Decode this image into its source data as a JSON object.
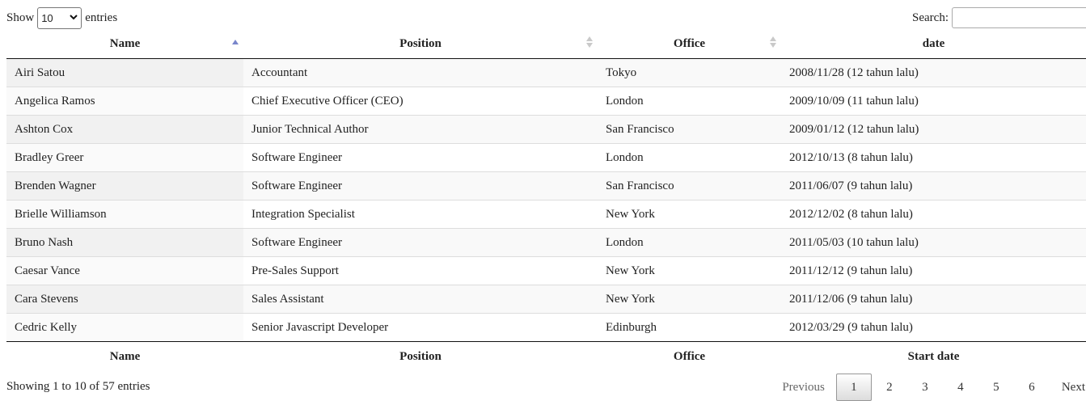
{
  "length": {
    "prefix": "Show",
    "value": "10",
    "suffix": "entries"
  },
  "search": {
    "label": "Search:",
    "value": "",
    "placeholder": ""
  },
  "table": {
    "headers": [
      "Name",
      "Position",
      "Office",
      "date"
    ],
    "footers": [
      "Name",
      "Position",
      "Office",
      "Start date"
    ],
    "sorted_column": "Name",
    "sort_direction": "ascending",
    "rows": [
      [
        "Airi Satou",
        "Accountant",
        "Tokyo",
        "2008/11/28 (12 tahun lalu)"
      ],
      [
        "Angelica Ramos",
        "Chief Executive Officer (CEO)",
        "London",
        "2009/10/09 (11 tahun lalu)"
      ],
      [
        "Ashton Cox",
        "Junior Technical Author",
        "San Francisco",
        "2009/01/12 (12 tahun lalu)"
      ],
      [
        "Bradley Greer",
        "Software Engineer",
        "London",
        "2012/10/13 (8 tahun lalu)"
      ],
      [
        "Brenden Wagner",
        "Software Engineer",
        "San Francisco",
        "2011/06/07 (9 tahun lalu)"
      ],
      [
        "Brielle Williamson",
        "Integration Specialist",
        "New York",
        "2012/12/02 (8 tahun lalu)"
      ],
      [
        "Bruno Nash",
        "Software Engineer",
        "London",
        "2011/05/03 (10 tahun lalu)"
      ],
      [
        "Caesar Vance",
        "Pre-Sales Support",
        "New York",
        "2011/12/12 (9 tahun lalu)"
      ],
      [
        "Cara Stevens",
        "Sales Assistant",
        "New York",
        "2011/12/06 (9 tahun lalu)"
      ],
      [
        "Cedric Kelly",
        "Senior Javascript Developer",
        "Edinburgh",
        "2012/03/29 (9 tahun lalu)"
      ]
    ]
  },
  "info": "Showing 1 to 10 of 57 entries",
  "pagination": {
    "previous": "Previous",
    "pages": [
      "1",
      "2",
      "3",
      "4",
      "5",
      "6"
    ],
    "current": "1",
    "next": "Next"
  },
  "icons": {
    "sort_active": "sort-ascending-icon",
    "sort_inactive": "sort-both-icon",
    "select_chevron": "chevron-down-icon"
  },
  "colors": {
    "sort_active": "#7986cb",
    "sort_inactive": "#c9c9c9",
    "row_stripe": "#f9f9f9"
  }
}
